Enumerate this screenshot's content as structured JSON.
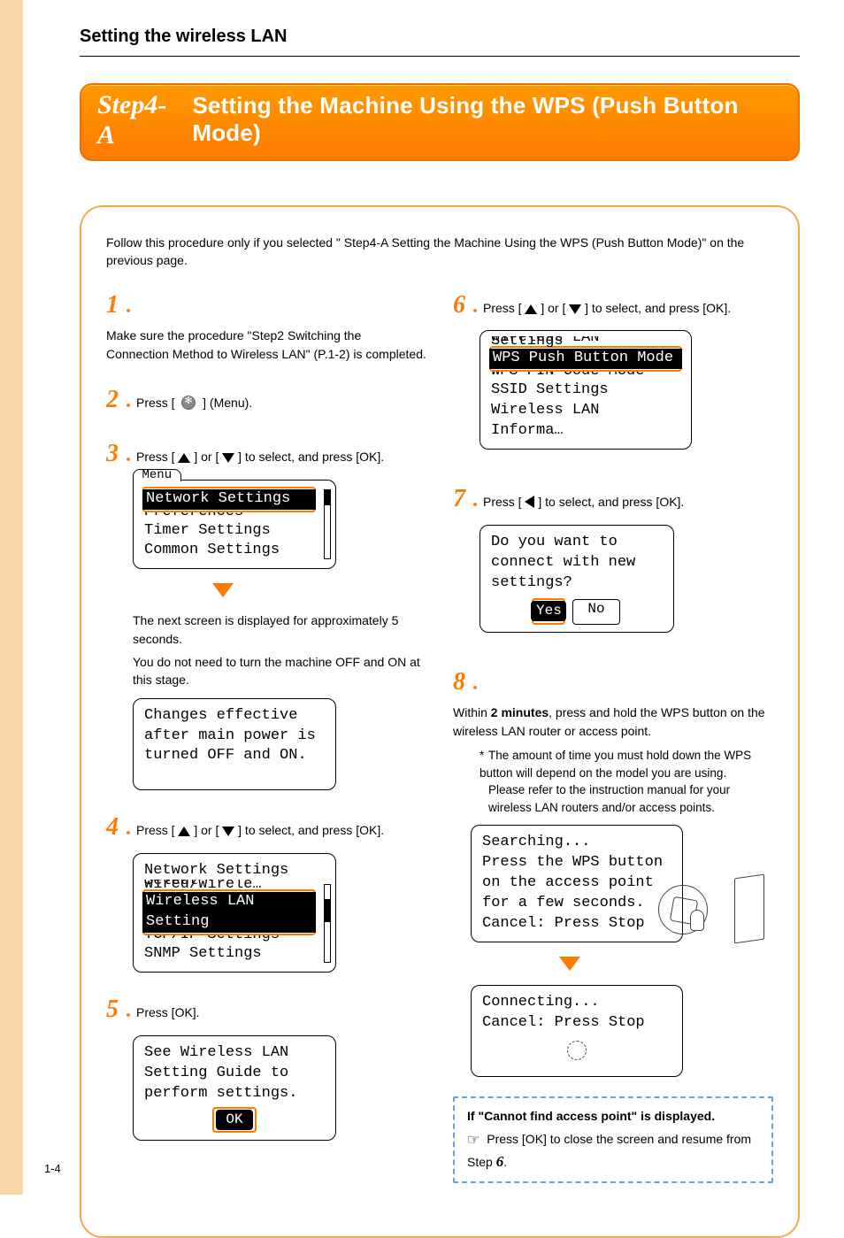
{
  "sectionTitle": "Setting the wireless LAN",
  "banner": {
    "step": "Step4-A",
    "title": "Setting the Machine Using the WPS (Push Button Mode)"
  },
  "intro": "Follow this procedure only if you selected \" Step4-A Setting the Machine Using the WPS (Push Button Mode)\" on the previous page.",
  "steps": {
    "s1": {
      "num": "1",
      "text": "Make sure the procedure \"Step2 Switching the Connection Method to Wireless LAN\" (P.1-2) is completed."
    },
    "s2": {
      "num": "2",
      "pre": "Press [",
      "post": "] (Menu)."
    },
    "s3": {
      "num": "3",
      "pre": "Press [",
      "mid": "] or [",
      "post": "] to select, and press [OK].",
      "lcdTab": "Menu",
      "lcdLines": {
        "sel": "Network Settings",
        "cutBelow": "Preferences",
        "l2": "Timer Settings",
        "l3": "Common Settings"
      },
      "note1": "The next screen is displayed for approximately 5 seconds.",
      "note2": "You do not need to turn the machine OFF and ON at this stage.",
      "lcd2": {
        "l1": "Changes effective",
        "l2": "after main power is",
        "l3": "turned OFF and ON."
      }
    },
    "s4": {
      "num": "4",
      "pre": "Press [",
      "mid": "] or [",
      "post": "] to select, and press [OK].",
      "lcdLines": {
        "title": "Network Settings",
        "cutAbove": "Select Wired/Wirele…",
        "sel": "Wireless LAN Setting",
        "cutBelow": "TCP/IP Settings",
        "l4": "SNMP Settings"
      }
    },
    "s5": {
      "num": "5",
      "text": "Press [OK].",
      "lcd": {
        "l1": "See Wireless LAN",
        "l2": "Setting Guide to",
        "l3": "perform settings.",
        "ok": "OK"
      }
    },
    "s6": {
      "num": "6",
      "pre": "Press [",
      "mid": "] or [",
      "post": "] to select, and press [OK].",
      "lcdLines": {
        "cutAbove": "Wireless LAN Settings",
        "sel": "WPS Push Button Mode",
        "cutBelow": "WPS PIN Code Mode",
        "l3": "SSID Settings",
        "l4": "Wireless LAN Informa…"
      }
    },
    "s7": {
      "num": "7",
      "pre": "Press [",
      "post": "] to select, and press [OK].",
      "lcd": {
        "l1": "Do you want to",
        "l2": "connect with new",
        "l3": "settings?",
        "yes": "Yes",
        "no": "No"
      }
    },
    "s8": {
      "num": "8",
      "pre": "Within ",
      "bold": "2 minutes",
      "post": ", press and hold the WPS button on the wireless LAN router or access point.",
      "note1": "The amount of time you must hold down the WPS button will depend on the model you are using.",
      "note2": "Please refer to the instruction manual for your wireless LAN routers and/or access points.",
      "lcdA": {
        "l1": "Searching...",
        "l2": "Press the WPS button",
        "l3": "on the access point",
        "l4": "for a few seconds.",
        "l5": "Cancel: Press Stop"
      },
      "lcdB": {
        "l1": "Connecting...",
        "l2": "Cancel: Press Stop"
      }
    }
  },
  "noteBox": {
    "title": "If \"Cannot find access point\" is displayed.",
    "line": "Press [OK] to close the screen and resume from Step",
    "stepRef": "6",
    "tail": "."
  },
  "pageNum": "1-4"
}
